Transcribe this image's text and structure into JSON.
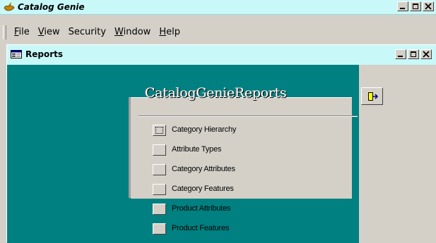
{
  "app": {
    "title": "Catalog Genie"
  },
  "menu": [
    {
      "label": "File",
      "accel": "F",
      "rest": "ile"
    },
    {
      "label": "View",
      "accel": "V",
      "rest": "iew"
    },
    {
      "label": "Security",
      "accel": "",
      "rest": "Security"
    },
    {
      "label": "Window",
      "accel": "W",
      "rest": "indow"
    },
    {
      "label": "Help",
      "accel": "H",
      "rest": "elp"
    }
  ],
  "child": {
    "title": "Reports"
  },
  "reports": {
    "header": "CatalogGenieReports",
    "items": [
      "Category Hierarchy",
      "Attribute Types",
      "Category Attributes",
      "Category Features",
      "Product Attributes",
      "Product Features"
    ]
  },
  "icons": {
    "app": "genie-lamp-icon",
    "child": "form-icon",
    "exit": "exit-door-icon"
  }
}
